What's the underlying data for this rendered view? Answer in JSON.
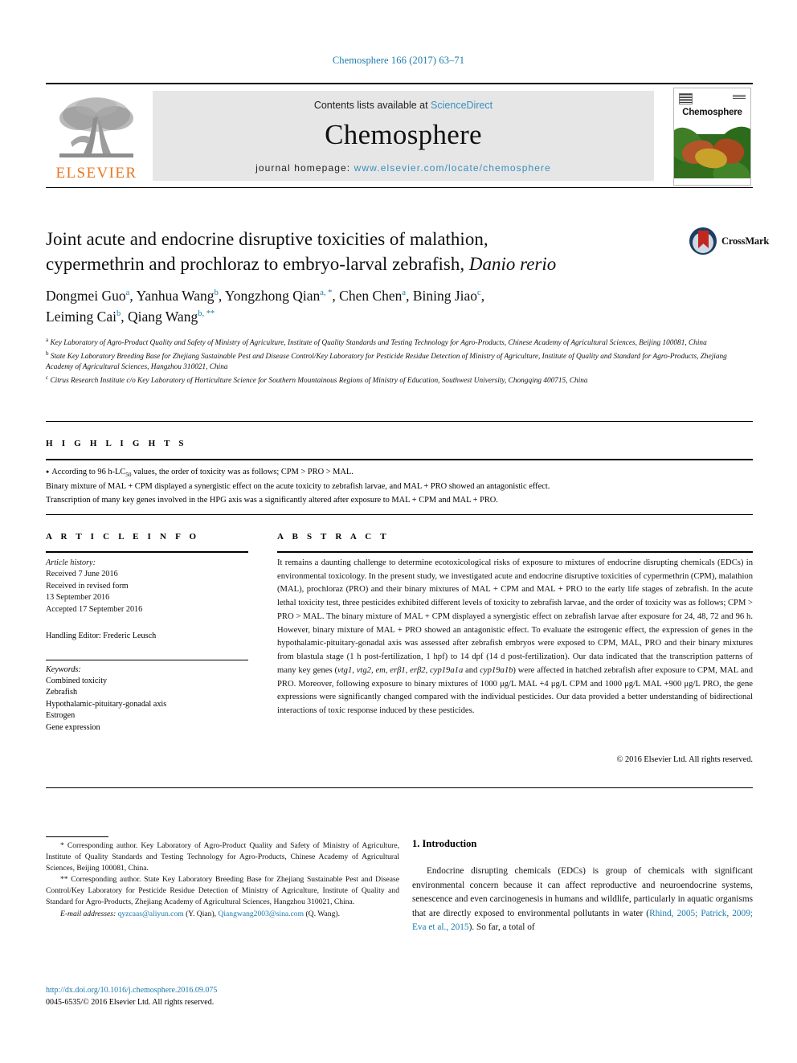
{
  "running_head": "Chemosphere 166 (2017) 63–71",
  "masthead": {
    "contents_prefix": "Contents lists available at ",
    "sciencedirect": "ScienceDirect",
    "journal_name": "Chemosphere",
    "homepage_prefix": "journal homepage: ",
    "homepage_url": "www.elsevier.com/locate/chemosphere",
    "publisher_logo_text": "ELSEVIER",
    "cover_title": "Chemosphere"
  },
  "crossmark": {
    "label": "CrossMark"
  },
  "article": {
    "title_line1": "Joint acute and endocrine disruptive toxicities of malathion,",
    "title_line2_plain": "cypermethrin and prochloraz to embryo-larval zebrafish, ",
    "title_line2_italic": "Danio rerio",
    "authors_line1": "Dongmei Guo , Yanhua Wang , Yongzhong Qian , Chen Chen , Bining Jiao ,",
    "authors_line2": "Leiming Cai , Qiang Wang",
    "author_list": [
      {
        "name": "Dongmei Guo",
        "sup": "a"
      },
      {
        "name": "Yanhua Wang",
        "sup": "b"
      },
      {
        "name": "Yongzhong Qian",
        "sup": "a, *"
      },
      {
        "name": "Chen Chen",
        "sup": "a"
      },
      {
        "name": "Bining Jiao",
        "sup": "c"
      },
      {
        "name": "Leiming Cai",
        "sup": "b"
      },
      {
        "name": "Qiang Wang",
        "sup": "b, **"
      }
    ],
    "affiliations": [
      {
        "marker": "a",
        "text": "Key Laboratory of Agro-Product Quality and Safety of Ministry of Agriculture, Institute of Quality Standards and Testing Technology for Agro-Products, Chinese Academy of Agricultural Sciences, Beijing 100081, China"
      },
      {
        "marker": "b",
        "text": "State Key Laboratory Breeding Base for Zhejiang Sustainable Pest and Disease Control/Key Laboratory for Pesticide Residue Detection of Ministry of Agriculture, Institute of Quality and Standard for Agro-Products, Zhejiang Academy of Agricultural Sciences, Hangzhou 310021, China"
      },
      {
        "marker": "c",
        "text": "Citrus Research Institute c/o Key Laboratory of Horticulture Science for Southern Mountainous Regions of Ministry of Education, Southwest University, Chongqing 400715, China"
      }
    ]
  },
  "highlights": {
    "heading": "H I G H L I G H T S",
    "items": [
      "According to 96 h-LC50 values, the order of toxicity was as follows; CPM > PRO > MAL.",
      "Binary mixture of MAL + CPM displayed a synergistic effect on the acute toxicity to zebrafish larvae, and MAL + PRO showed an antagonistic effect.",
      "Transcription of many key genes involved in the HPG axis was a significantly altered after exposure to MAL + CPM and MAL + PRO."
    ]
  },
  "article_info": {
    "heading": "A R T I C L E  I N F O",
    "history_label": "Article history:",
    "history": [
      "Received 7 June 2016",
      "Received in revised form",
      "13 September 2016",
      "Accepted 17 September 2016"
    ],
    "handling_editor": "Handling Editor: Frederic Leusch",
    "keywords_label": "Keywords:",
    "keywords": [
      "Combined toxicity",
      "Zebrafish",
      "Hypothalamic-pituitary-gonadal axis",
      "Estrogen",
      "Gene expression"
    ]
  },
  "abstract": {
    "heading": "A B S T R A C T",
    "text_part1": "It remains a daunting challenge to determine ecotoxicological risks of exposure to mixtures of endocrine disrupting chemicals (EDCs) in environmental toxicology. In the present study, we investigated acute and endocrine disruptive toxicities of cypermethrin (CPM), malathion (MAL), prochloraz (PRO) and their binary mixtures of MAL + CPM and MAL + PRO to the early life stages of zebrafish. In the acute lethal toxicity test, three pesticides exhibited different levels of toxicity to zebrafish larvae, and the order of toxicity was as follows; CPM > PRO > MAL. The binary mixture of MAL + CPM displayed a synergistic effect on zebrafish larvae after exposure for 24, 48, 72 and 96 h. However, binary mixture of MAL + PRO showed an antagonistic effect. To evaluate the estrogenic effect, the expression of genes in the hypothalamic-pituitary-gonadal axis was assessed after zebrafish embryos were exposed to CPM, MAL, PRO and their binary mixtures from blastula stage (1 h post-fertilization, 1 hpf) to 14 dpf (14 d post-fertilization). Our data indicated that the transcription patterns of many key genes (",
    "genes_italic_1": "vtg1, vtg2, em, erβ1, erβ2, cyp19a1a",
    "genes_join": " and ",
    "genes_italic_2": "cyp19a1b",
    "text_part2": ") were affected in hatched zebrafish after exposure to CPM, MAL and PRO. Moreover, following exposure to binary mixtures of 1000 μg/L MAL +4 μg/L CPM and 1000 μg/L MAL +900 μg/L PRO, the gene expressions were significantly changed compared with the individual pesticides. Our data provided a better understanding of bidirectional interactions of toxic response induced by these pesticides.",
    "copyright": "© 2016 Elsevier Ltd. All rights reserved."
  },
  "footnotes": {
    "corresponding1": "* Corresponding author. Key Laboratory of Agro-Product Quality and Safety of Ministry of Agriculture, Institute of Quality Standards and Testing Technology for Agro-Products, Chinese Academy of Agricultural Sciences, Beijing 100081, China.",
    "corresponding2": "** Corresponding author. State Key Laboratory Breeding Base for Zhejiang Sustainable Pest and Disease Control/Key Laboratory for Pesticide Residue Detection of Ministry of Agriculture, Institute of Quality and Standard for Agro-Products, Zhejiang Academy of Agricultural Sciences, Hangzhou 310021, China.",
    "email_label": "E-mail addresses:",
    "email1": "qyzcaas@aliyun.com",
    "email1_owner": "(Y. Qian),",
    "email2": "Qiangwang2003@sina.com",
    "email2_owner": "(Q. Wang)."
  },
  "footer": {
    "doi": "http://dx.doi.org/10.1016/j.chemosphere.2016.09.075",
    "issn_line": "0045-6535/© 2016 Elsevier Ltd. All rights reserved."
  },
  "introduction": {
    "heading": "1. Introduction",
    "para_before_cite": "Endocrine disrupting chemicals (EDCs) is group of chemicals with significant environmental concern because it can affect reproductive and neuroendocrine systems, senescence and even carcinogenesis in humans and wildlife, particularly in aquatic organisms that are directly exposed to environmental pollutants in water (",
    "citation": "Rhind, 2005; Patrick, 2009; Eva et al., 2015",
    "para_after_cite": "). So far, a total of"
  },
  "colors": {
    "link_blue": "#1a7bab",
    "sciencedirect_blue": "#3a8fbd",
    "elsevier_orange": "#E87722",
    "masthead_grey": "#e6e6e6",
    "crossmark_navy": "#1d3f63",
    "crossmark_red": "#c0281f"
  }
}
